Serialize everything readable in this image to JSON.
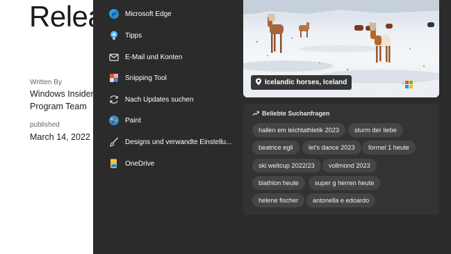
{
  "blog": {
    "title": "Relea",
    "written_by_label": "Written By",
    "author": "Windows Insider Program Team",
    "published_label": "published",
    "date": "March 14, 2022"
  },
  "apps": [
    {
      "label": "Microsoft Edge",
      "icon": "edge-icon"
    },
    {
      "label": "Tipps",
      "icon": "tips-icon"
    },
    {
      "label": "E-Mail und Konten",
      "icon": "mail-icon"
    },
    {
      "label": "Snipping Tool",
      "icon": "snipping-tool-icon"
    },
    {
      "label": "Nach Updates suchen",
      "icon": "refresh-icon"
    },
    {
      "label": "Paint",
      "icon": "paint-icon"
    },
    {
      "label": "Designs und verwandte Einstellu...",
      "icon": "brush-icon"
    },
    {
      "label": "OneDrive",
      "icon": "onedrive-icon"
    }
  ],
  "photo": {
    "caption": "Icelandic horses, Iceland"
  },
  "searches": {
    "title": "Beliebte Suchanfragen",
    "items": [
      "hallen em leichtathletik 2023",
      "sturm der liebe",
      "beatrice egli",
      "let's dance 2023",
      "formel 1 heute",
      "ski weltcup 2022/23",
      "vollmond 2023",
      "biathlon heute",
      "super g herren heute",
      "helene fischer",
      "antonella e edoardo"
    ]
  },
  "colors": {
    "panel_bg": "#2b2b2b",
    "card_bg": "#333333",
    "chip_bg": "#454545"
  }
}
